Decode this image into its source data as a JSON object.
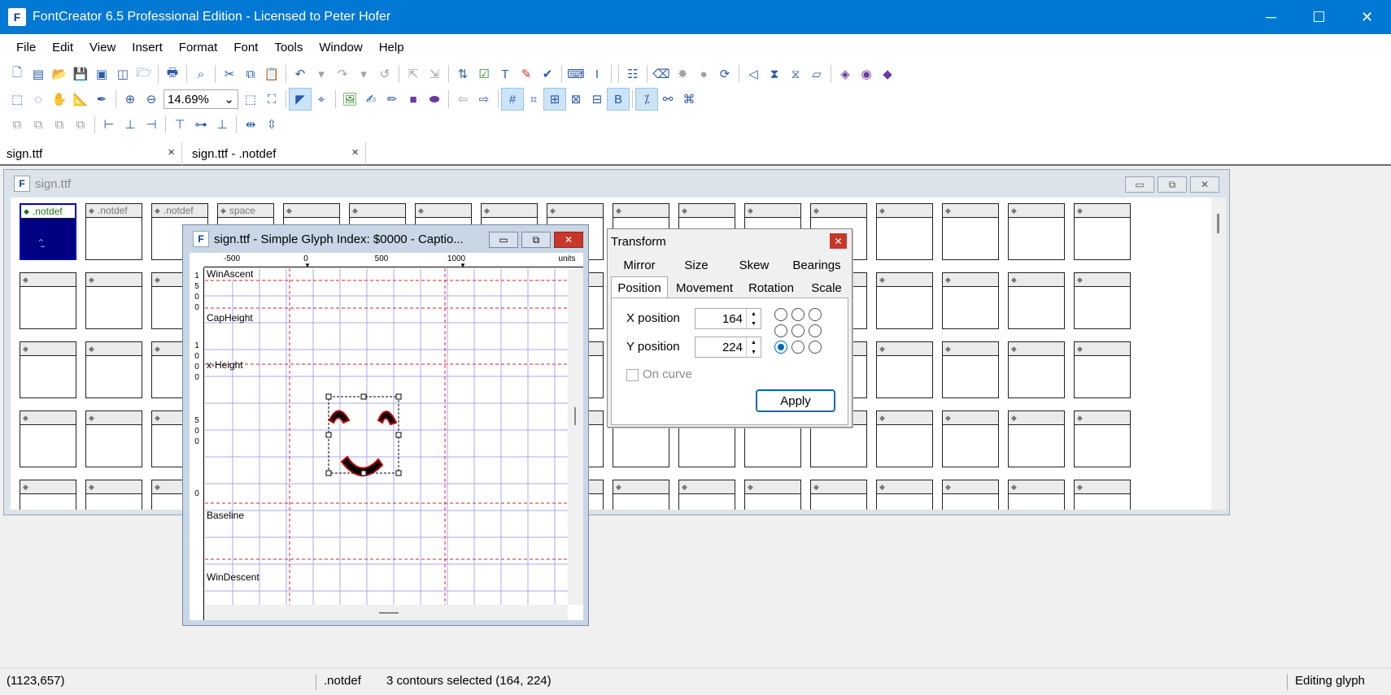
{
  "window": {
    "title": "FontCreator 6.5 Professional Edition - Licensed to Peter Hofer",
    "controls": {
      "minimize": "─",
      "maximize": "☐",
      "close": "✕"
    }
  },
  "menu": [
    "File",
    "Edit",
    "View",
    "Insert",
    "Format",
    "Font",
    "Tools",
    "Window",
    "Help"
  ],
  "toolbar": {
    "zoom_value": "14.69%"
  },
  "doc_tabs": [
    {
      "label": "sign.ttf",
      "close": "×"
    },
    {
      "label": "sign.ttf - .notdef",
      "close": "×"
    }
  ],
  "font_window": {
    "title": "sign.ttf",
    "header_cells": [
      ".notdef",
      ".notdef",
      ".notdef",
      "space"
    ]
  },
  "glyph_window": {
    "title": "sign.ttf - Simple Glyph Index: $0000 - Captio...",
    "ruler_top": [
      "-500",
      "0",
      "500",
      "1000",
      "units"
    ],
    "ruler_left": [
      "1\n5\n0\n0",
      "1\n0\n0\n0",
      "5\n0\n0",
      "0"
    ],
    "guides": [
      "WinAscent",
      "CapHeight",
      "x-Height",
      "Baseline",
      "WinDescent"
    ]
  },
  "transform": {
    "title": "Transform",
    "tabs_row1": [
      "Mirror",
      "Size",
      "Skew",
      "Bearings"
    ],
    "tabs_row2": [
      "Position",
      "Movement",
      "Rotation",
      "Scale"
    ],
    "active_tab": "Position",
    "x_label": "X position",
    "x_value": "164",
    "y_label": "Y position",
    "y_value": "224",
    "on_curve_label": "On curve",
    "on_curve_checked": false,
    "anchor_selected": "bottom-left",
    "apply_label": "Apply"
  },
  "status": {
    "coords": "(1123,657)",
    "glyph": ".notdef",
    "selection": "3 contours selected (164, 224)",
    "mode": "Editing glyph"
  },
  "colors": {
    "titlebar": "#0078d4",
    "selected_cell": "#000080",
    "guide_line": "#e02020",
    "grid_line": "#a8a8f0"
  }
}
